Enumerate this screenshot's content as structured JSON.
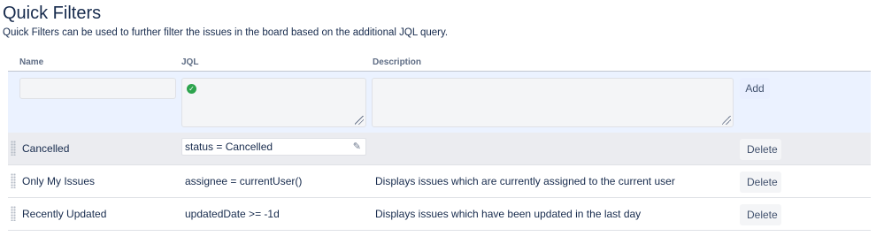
{
  "page": {
    "title": "Quick Filters",
    "description": "Quick Filters can be used to further filter the issues in the board based on the additional JQL query."
  },
  "table": {
    "headers": {
      "name": "Name",
      "jql": "JQL",
      "description": "Description"
    },
    "add_row": {
      "name_value": "",
      "jql_value": "",
      "description_value": "",
      "add_label": "Add",
      "jql_status_icon": "check-circle-icon"
    },
    "rows": [
      {
        "name": "Cancelled",
        "jql": "status = Cancelled",
        "description": "",
        "delete_label": "Delete"
      },
      {
        "name": "Only My Issues",
        "jql": "assignee = currentUser()",
        "description": "Displays issues which are currently assigned to the current user",
        "delete_label": "Delete"
      },
      {
        "name": "Recently Updated",
        "jql": "updatedDate >= -1d",
        "description": "Displays issues which have been updated in the last day",
        "delete_label": "Delete"
      }
    ]
  },
  "icons": {
    "edit": "pencil-icon",
    "drag": "drag-handle-icon",
    "valid": "check-circle-icon"
  },
  "colors": {
    "add_row_bg": "#ebf2ff",
    "selected_row_bg": "#ebecf0",
    "valid": "#2da44e",
    "text": "#172b4d"
  }
}
